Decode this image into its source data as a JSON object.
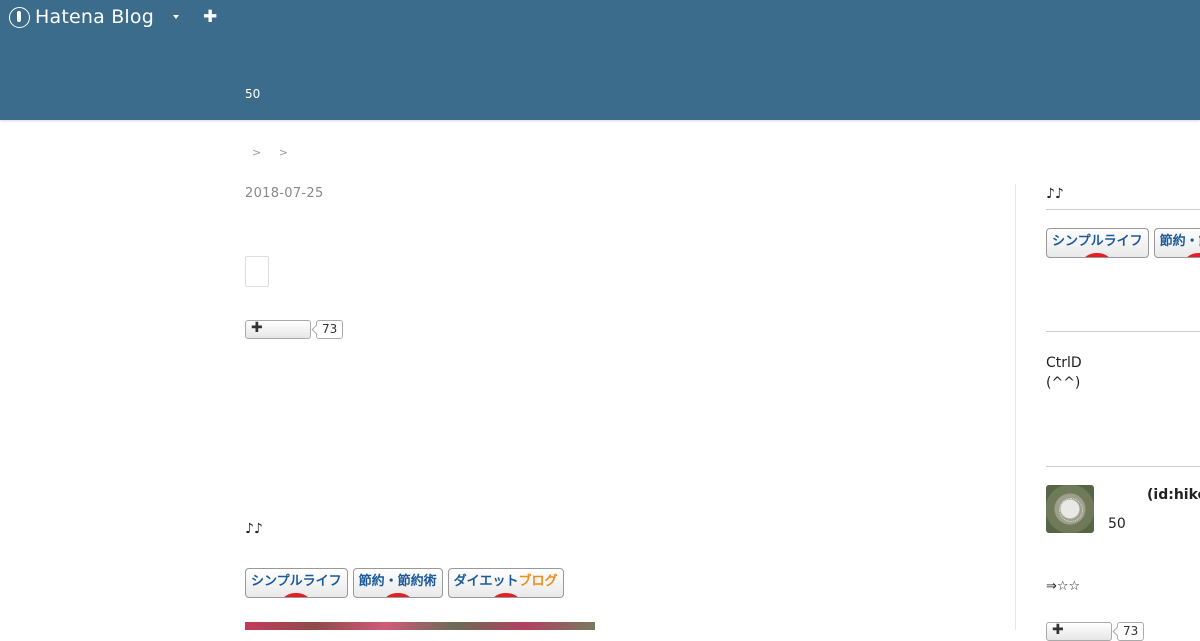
{
  "header": {
    "logo_text": "Hatena Blog",
    "add_symbol": "✚",
    "blog_description": "50"
  },
  "breadcrumb": {
    "sep1": ">",
    "sep2": ">"
  },
  "entry": {
    "date": "2018-07-25",
    "bookmark_symbol": "✚",
    "bookmark_count": "73",
    "notes": "♪♪",
    "badges": {
      "simple_life": "シンプルライフ",
      "setsuyaku": "節約・節約術",
      "diet_prefix": "ダイエット",
      "diet_suffix": "ブログ"
    }
  },
  "sidebar": {
    "notes": "♪♪",
    "badges": {
      "simple_life": "シンプルライフ",
      "setsuyaku": "節約・節約術"
    },
    "text_line1": "CtrlD",
    "text_line2": "(^^)",
    "profile_id": "(id:hikor",
    "profile_num": "50",
    "profile_stars": "⇒☆☆",
    "bookmark_count": "73"
  },
  "colors": {
    "header_bg": "#3c6c8c",
    "badge_text": "#1a5a9c",
    "badge_accent": "#e21f26"
  }
}
